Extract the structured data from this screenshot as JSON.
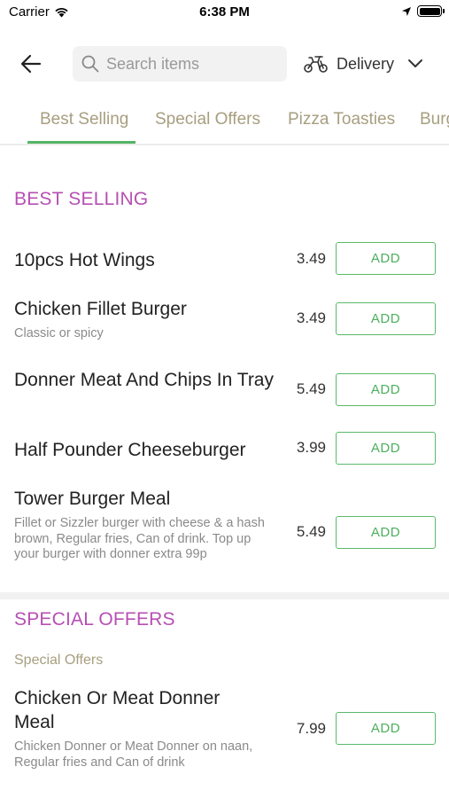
{
  "status": {
    "carrier": "Carrier",
    "time": "6:38 PM"
  },
  "header": {
    "search_placeholder": "Search items",
    "delivery_label": "Delivery"
  },
  "tabs": [
    {
      "label": "Best Selling",
      "active": true
    },
    {
      "label": "Special Offers",
      "active": false
    },
    {
      "label": "Pizza Toasties",
      "active": false
    },
    {
      "label": "Burg",
      "active": false
    }
  ],
  "sections": {
    "best_selling": {
      "title": "BEST SELLING",
      "items": [
        {
          "name": "10pcs Hot Wings",
          "description": "",
          "price": "3.49"
        },
        {
          "name": "Chicken Fillet Burger",
          "description": "Classic or spicy",
          "price": "3.49"
        },
        {
          "name": "Donner Meat And Chips In Tray",
          "description": "",
          "price": "5.49"
        },
        {
          "name": "Half Pounder Cheeseburger",
          "description": "",
          "price": "3.99"
        },
        {
          "name": "Tower Burger Meal",
          "description": "Fillet or Sizzler burger with cheese & a hash brown, Regular fries, Can of drink. Top up your burger with donner extra 99p",
          "price": "5.49"
        }
      ]
    },
    "special_offers": {
      "title": "SPECIAL OFFERS",
      "subtitle": "Special Offers",
      "items": [
        {
          "name": "Chicken Or Meat Donner Meal",
          "description": "Chicken Donner or Meat Donner on naan, Regular fries and Can of drink",
          "price": "7.99"
        }
      ]
    }
  },
  "add_label": "ADD",
  "colors": {
    "section_title": "#b64fb3",
    "tab_text": "#a79e7f",
    "accent_green": "#55b466"
  },
  "icons": {
    "back": "arrow-left-icon",
    "search": "search-icon",
    "delivery": "scooter-icon",
    "dropdown": "chevron-down-icon"
  }
}
